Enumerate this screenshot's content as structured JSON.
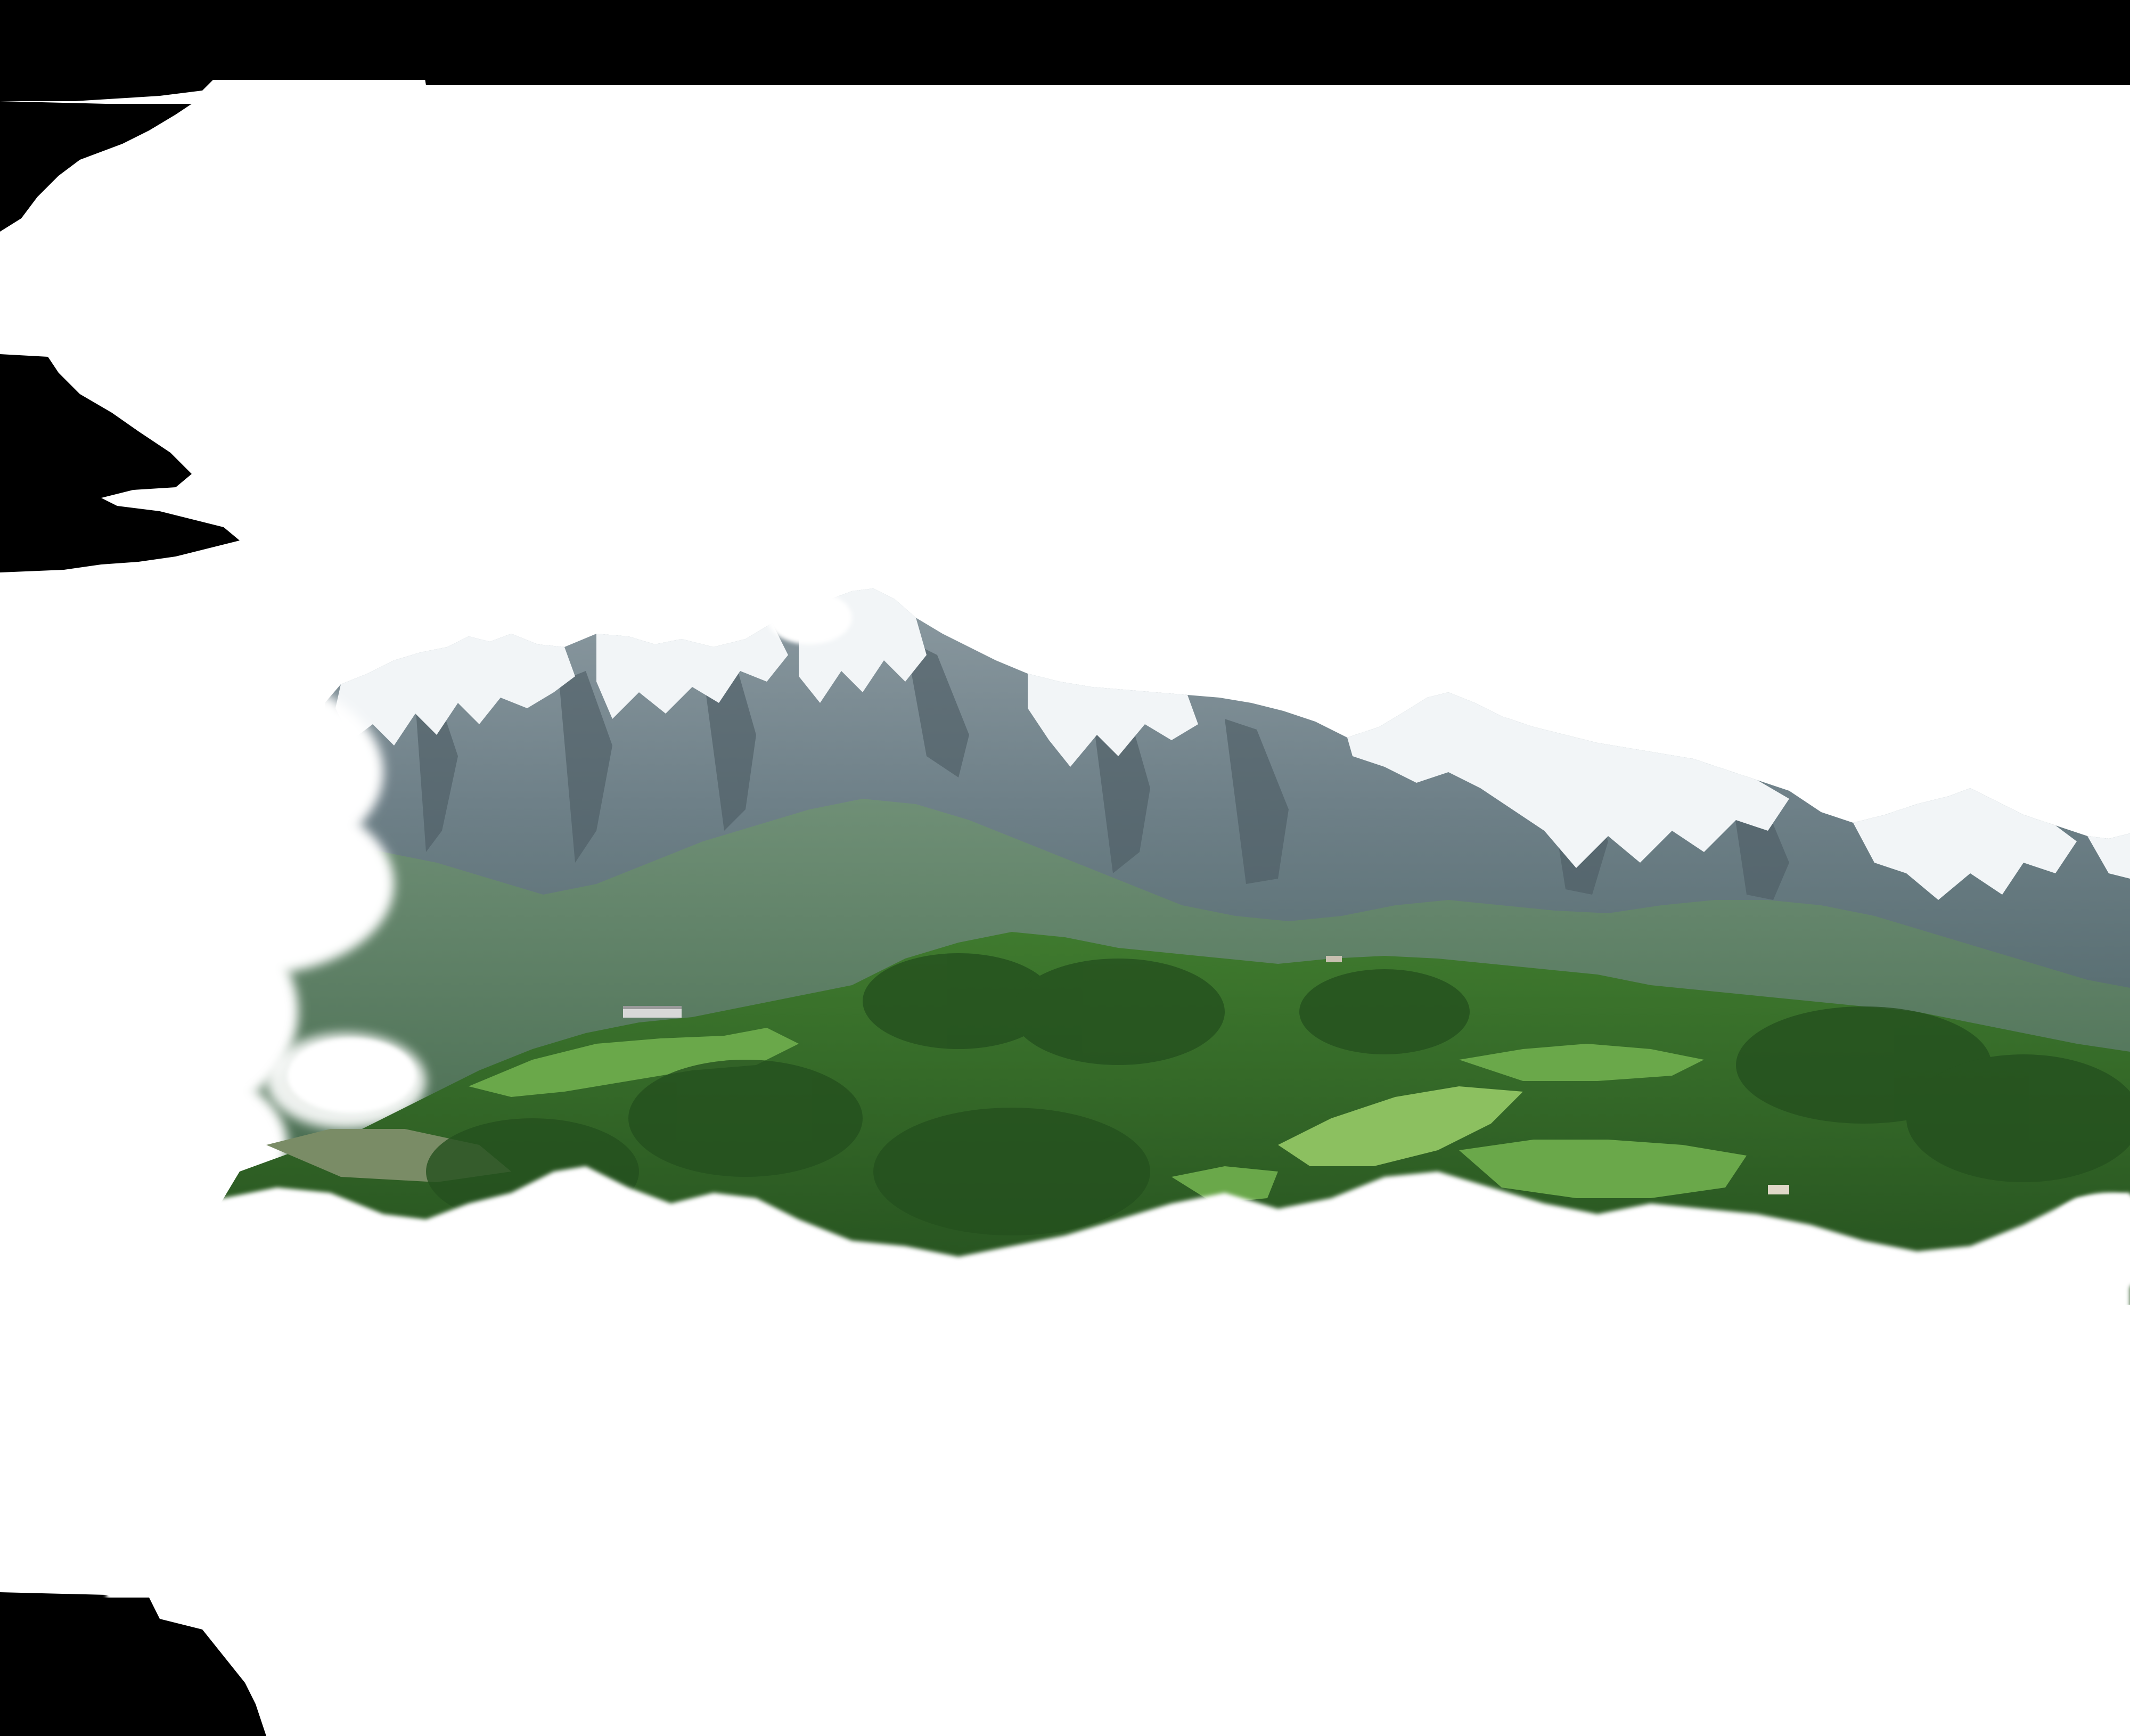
{
  "scene": {
    "subjects": [
      "sky",
      "mist",
      "snow-capped-mountain-range",
      "forested-hills",
      "meadows",
      "farm-buildings",
      "low-clouds"
    ],
    "colors": {
      "background": "#000000",
      "cloud": "#ffffff",
      "rock": "#7d8c93",
      "rock_shadow": "#4e5e66",
      "snow": "#f2f5f7",
      "mountain_forest": "#5e8066",
      "hill_forest_dark": "#24501e",
      "hill_forest": "#3c7a2c",
      "meadow": "#6aa84a",
      "meadow_light": "#8cc060"
    }
  }
}
